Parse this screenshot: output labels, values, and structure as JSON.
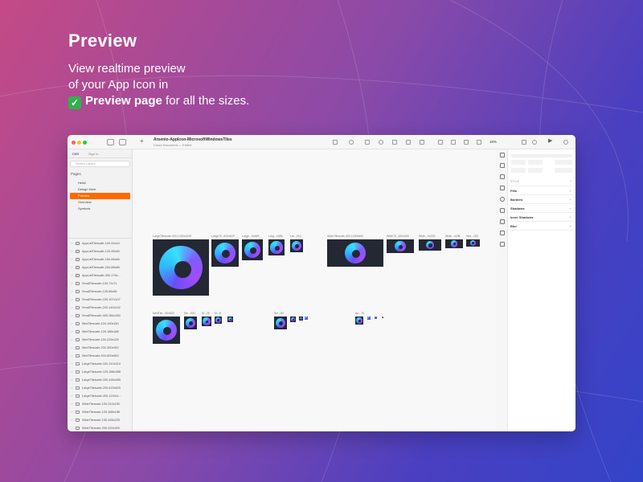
{
  "promo": {
    "headline": "Preview",
    "line1": "View realtime preview",
    "line2": "of your App Icon in",
    "check": "✓",
    "line3_bold": "Preview page",
    "line3_rest": " for all the sizes."
  },
  "window": {
    "doc_title": "Arsenio-AppIcon-MicrosoftWindowsTiles",
    "doc_subtitle": "Cloud Document — Edited",
    "zoom": "16%",
    "tabs": [
      "DBR",
      "Sign In"
    ],
    "search_placeholder": "Search Layers",
    "pages_label": "Pages",
    "pages": [
      "Hello!",
      "Design Here",
      "Preview",
      "Overview",
      "Symbols"
    ],
    "active_page_index": 2,
    "layers": [
      "AppListTilescale-100-44x44",
      "AppListTilescale-125-55x55",
      "AppListTilescale-150-66x66",
      "AppListTilescale-200-88x88",
      "AppListTilescale-400-176x...",
      "SmallTilescale-100-71x71",
      "SmallTilescale-125-89x89",
      "SmallTilescale-150-107x107",
      "SmallTilescale-200-142x142",
      "SmallTilescale-400-284x284",
      "MedTilescale-100-150x150",
      "MedTilescale-125-188x188",
      "MedTilescale-150-225x225",
      "MedTilescale-200-300x300",
      "MedTilescale-400-600x600",
      "LargeTilescale-100-310x310",
      "LargeTilescale-125-388x388",
      "LargeTilescale-150-465x465",
      "LargeTilescale-200-620x620",
      "LargeTilescale-400-1240x1...",
      "WideTilescale-100-310x150",
      "WideTilescale-125-388x188",
      "WideTilescale-150-465x225",
      "WideTilescale-200-620x300",
      "WideTilescale-400-1240x6..."
    ],
    "artboards_row1": [
      "LargeTilescale-400-1240x1240",
      "LargeTil...620x620",
      "Large...5x465",
      "Larg...x388",
      "Lar...310",
      "WideTilescale-400-1240x600",
      "WideTil...620x300",
      "Wide...5x225",
      "Wide...x188",
      "Wid...150"
    ],
    "artboards_row2": [
      "MedTile...00x600",
      "Me...300",
      "M...25",
      "M...8",
      "",
      "Sm...84",
      "",
      "",
      "",
      "Ap...76",
      "",
      "",
      ""
    ],
    "inspector": {
      "style_label": "STYLE",
      "sections": [
        "Fills",
        "Borders",
        "Shadows",
        "Inner Shadows",
        "Blur"
      ],
      "plus": "+"
    }
  },
  "colors": {
    "accent": "#ff6a00",
    "tile_bg": "#232833",
    "traffic": [
      "#ff5f57",
      "#febc2e",
      "#28c840"
    ]
  }
}
